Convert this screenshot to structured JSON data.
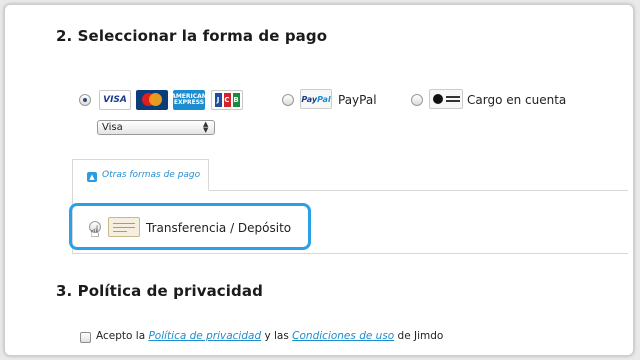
{
  "section2": {
    "title": "2. Seleccionar la forma de pago"
  },
  "payment": {
    "cards_option": {
      "selected": true,
      "brands": [
        "VISA",
        "MasterCard",
        "AMERICAN EXPRESS",
        "JCB"
      ],
      "select_value": "Visa"
    },
    "paypal_option": {
      "selected": false,
      "label": "PayPal",
      "logo_text": "PayPal"
    },
    "direct_debit_option": {
      "selected": false,
      "label": "Cargo en cuenta"
    }
  },
  "other_methods": {
    "tab_label": "Otras formas de pago",
    "tab_icon": "chevron-up-icon",
    "bank_transfer": {
      "selected": false,
      "label": "Transferencia / Depósito"
    }
  },
  "section3": {
    "title": "3. Política de privacidad"
  },
  "privacy": {
    "checked": false,
    "prefix": "Acepto la ",
    "privacy_link": "Política de privacidad",
    "mid": " y las ",
    "terms_link": "Condiciones de uso",
    "suffix": " de Jimdo"
  },
  "colors": {
    "accent": "#2aa0e6",
    "link": "#1a8ed0"
  }
}
